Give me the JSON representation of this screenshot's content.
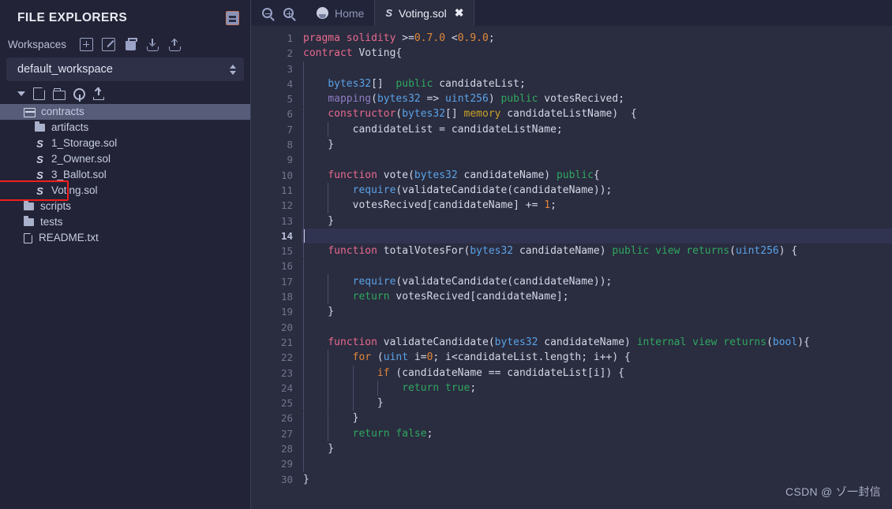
{
  "sidebar": {
    "title": "FILE EXPLORERS",
    "panel_icon": "book-panel-icon",
    "workspaces": {
      "label": "Workspaces",
      "actions": [
        {
          "name": "create-workspace",
          "icon": "plus-square-icon"
        },
        {
          "name": "rename-workspace",
          "icon": "pencil-square-icon"
        },
        {
          "name": "delete-workspace",
          "icon": "trash-icon"
        },
        {
          "name": "import-workspace",
          "icon": "tray-download-icon"
        },
        {
          "name": "export-workspace",
          "icon": "tray-upload-icon"
        }
      ],
      "selected": "default_workspace"
    },
    "tree_tools": [
      {
        "name": "collapse-caret",
        "icon": "caret-down-icon"
      },
      {
        "name": "new-file",
        "icon": "new-file-icon"
      },
      {
        "name": "new-folder",
        "icon": "new-folder-icon"
      },
      {
        "name": "connect-git",
        "icon": "git-icon"
      },
      {
        "name": "publish-gist",
        "icon": "publish-upload-icon"
      }
    ],
    "tree": [
      {
        "label": "contracts",
        "icon": "folder-open-icon",
        "indent": 1,
        "selected": true,
        "highlight": false
      },
      {
        "label": "artifacts",
        "icon": "folder-icon",
        "indent": 2,
        "selected": false,
        "highlight": false
      },
      {
        "label": "1_Storage.sol",
        "icon": "solidity-icon",
        "indent": 2,
        "selected": false,
        "highlight": false
      },
      {
        "label": "2_Owner.sol",
        "icon": "solidity-icon",
        "indent": 2,
        "selected": false,
        "highlight": false
      },
      {
        "label": "3_Ballot.sol",
        "icon": "solidity-icon",
        "indent": 2,
        "selected": false,
        "highlight": false
      },
      {
        "label": "Voting.sol",
        "icon": "solidity-icon",
        "indent": 2,
        "selected": false,
        "highlight": true
      },
      {
        "label": "scripts",
        "icon": "folder-icon",
        "indent": 1,
        "selected": false,
        "highlight": false
      },
      {
        "label": "tests",
        "icon": "folder-icon",
        "indent": 1,
        "selected": false,
        "highlight": false
      },
      {
        "label": "README.txt",
        "icon": "text-file-icon",
        "indent": 1,
        "selected": false,
        "highlight": false
      }
    ],
    "highlight_color": "#f01f1f"
  },
  "editor": {
    "zoom_controls": [
      {
        "name": "zoom-out",
        "icon": "magnifier-minus-icon"
      },
      {
        "name": "zoom-in",
        "icon": "magnifier-plus-icon"
      }
    ],
    "tabs": [
      {
        "label": "Home",
        "icon": "remix-logo-icon",
        "active": false,
        "closable": false
      },
      {
        "label": "Voting.sol",
        "icon": "solidity-icon",
        "active": true,
        "closable": true,
        "close_glyph": "✖"
      }
    ],
    "active_line": 14,
    "total_lines": 30,
    "line_numbers": [
      1,
      2,
      3,
      4,
      5,
      6,
      7,
      8,
      9,
      10,
      11,
      12,
      13,
      14,
      15,
      16,
      17,
      18,
      19,
      20,
      21,
      22,
      23,
      24,
      25,
      26,
      27,
      28,
      29,
      30
    ],
    "code_lines": [
      "pragma solidity >=0.7.0 <0.9.0;",
      "contract Voting{",
      "",
      "    bytes32[]  public candidateList;",
      "    mapping(bytes32 => uint256) public votesRecived;",
      "    constructor(bytes32[] memory candidateListName)  {",
      "        candidateList = candidateListName;",
      "    }",
      "",
      "    function vote(bytes32 candidateName) public{",
      "        require(validateCandidate(candidateName));",
      "        votesRecived[candidateName] += 1;",
      "    }",
      "",
      "    function totalVotesFor(bytes32 candidateName) public view returns(uint256) {",
      "",
      "        require(validateCandidate(candidateName));",
      "        return votesRecived[candidateName];",
      "    }",
      "",
      "    function validateCandidate(bytes32 candidateName) internal view returns(bool){",
      "        for (uint i=0; i<candidateList.length; i++) {",
      "            if (candidateName == candidateList[i]) {",
      "                return true;",
      "            }",
      "        }",
      "        return false;",
      "    }",
      "",
      "}"
    ],
    "language": "solidity",
    "filename": "Voting.sol"
  },
  "watermark": "CSDN @ ゾ一封信",
  "colors": {
    "sidebar_bg": "#222336",
    "editor_bg": "#2a2c3f",
    "tabbar_bg": "#22243a",
    "active_line_bg": "#313450",
    "selection_bg": "#575d79",
    "accent_red": "#f01f1f"
  }
}
